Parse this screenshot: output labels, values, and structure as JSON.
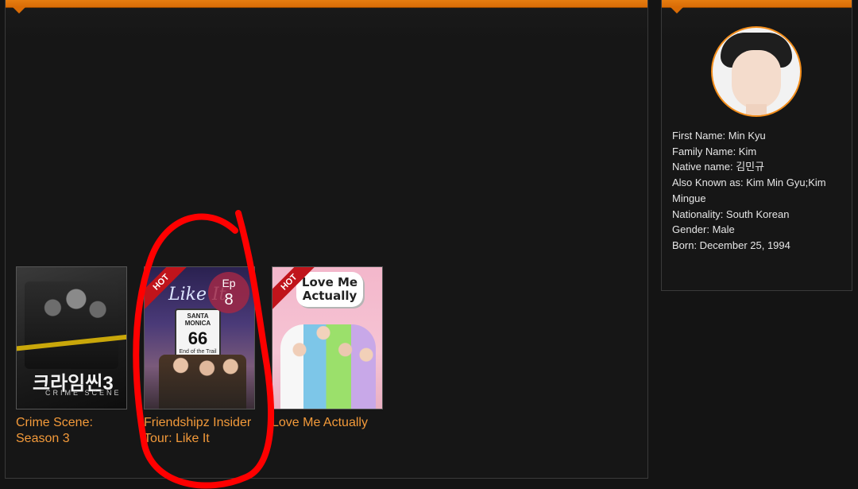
{
  "shows": [
    {
      "title": "Crime Scene: Season 3",
      "poster": {
        "text_main": "크라임씬3",
        "text_sub": "CRIME SCENE"
      },
      "hot": false
    },
    {
      "title": "Friendshipz Insider Tour: Like It",
      "poster": {
        "text_main": "Like It",
        "sign_top": "SANTA MONICA",
        "sign_number": "66",
        "sign_bottom": "End of the Trail"
      },
      "hot": true,
      "hot_label": "HOT",
      "episode": {
        "label": "Ep",
        "number": "8"
      }
    },
    {
      "title": "Love Me Actually",
      "poster": {
        "text_main": "Love Me Actually"
      },
      "hot": true,
      "hot_label": "HOT"
    }
  ],
  "profile": {
    "first_name": "First Name: Min Kyu",
    "family_name": "Family Name: Kim",
    "native_name": "Native name: 김민규",
    "aka": "Also Known as: Kim Min Gyu;Kim Mingue",
    "nationality": "Nationality: South Korean",
    "gender": "Gender: Male",
    "born": "Born: December 25, 1994"
  },
  "colors": {
    "accent": "#f28d1b",
    "title_link": "#f39a3a",
    "hot_ribbon": "#c0141b",
    "annotation": "#ff0000"
  }
}
